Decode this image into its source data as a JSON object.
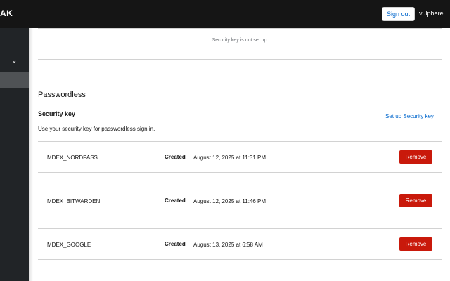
{
  "header": {
    "brand_fragment": "AK",
    "signout_label": "Sign out",
    "username": "vulphere"
  },
  "sidebar": {
    "chevron_glyph": "⌄"
  },
  "previous_section": {
    "empty_message": "Security key is not set up."
  },
  "passwordless": {
    "title": "Passwordless",
    "subtitle": "Security key",
    "setup_link": "Set up Security key",
    "help_text": "Use your security key for passwordless sign in.",
    "created_label": "Created",
    "remove_label": "Remove",
    "keys": [
      {
        "name": "MDEX_NORDPASS",
        "date": "August 12, 2025 at 11:31 PM"
      },
      {
        "name": "MDEX_BITWARDEN",
        "date": "August 12, 2025 at 11:46 PM"
      },
      {
        "name": "MDEX_GOOGLE",
        "date": "August 13, 2025 at 6:58 AM"
      }
    ]
  },
  "colors": {
    "topbar": "#151515",
    "sidebar": "#212427",
    "link": "#0066cc",
    "danger": "#c9190b"
  }
}
